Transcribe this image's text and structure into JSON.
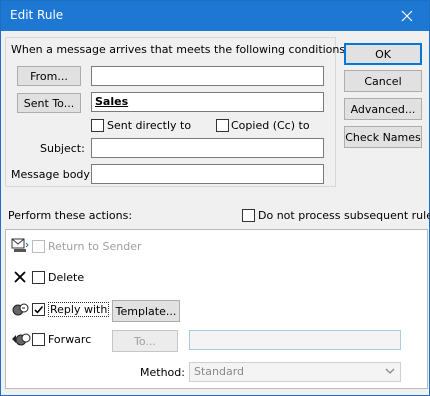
{
  "window": {
    "title": "Edit Rule"
  },
  "conditions": {
    "heading": "When a message arrives that meets the following conditions:",
    "from": {
      "label": "From...",
      "value": ""
    },
    "sent_to": {
      "label": "Sent To...",
      "value": "Sales"
    },
    "sent_directly": {
      "label": "Sent directly to",
      "checked": false
    },
    "copied": {
      "label": "Copied (Cc) to",
      "checked": false
    },
    "subject": {
      "label": "Subject:",
      "value": ""
    },
    "body": {
      "label": "Message body",
      "value": ""
    }
  },
  "buttons": {
    "ok": "OK",
    "cancel": "Cancel",
    "advanced": "Advanced...",
    "check_names": "Check Names"
  },
  "actions": {
    "heading": "Perform these actions:",
    "do_not_process": {
      "label": "Do not process subsequent rules",
      "checked": false
    },
    "return_to_sender": {
      "label": "Return to Sender",
      "checked": false,
      "enabled": false
    },
    "delete": {
      "label": "Delete",
      "checked": false
    },
    "reply_with": {
      "label": "Reply with",
      "checked": true,
      "template_label": "Template..."
    },
    "forward": {
      "label": "Forwarc",
      "checked": false,
      "to_label": "To...",
      "to_value": ""
    },
    "method": {
      "label": "Method:",
      "value": "Standard"
    }
  },
  "colors": {
    "titlebar": "#1e77d3",
    "accent": "#0078d7"
  },
  "icons": [
    "close-icon",
    "return-to-sender-icon",
    "delete-x-icon",
    "reply-with-icon",
    "forward-icon",
    "chevron-down-icon",
    "checkmark-icon"
  ]
}
